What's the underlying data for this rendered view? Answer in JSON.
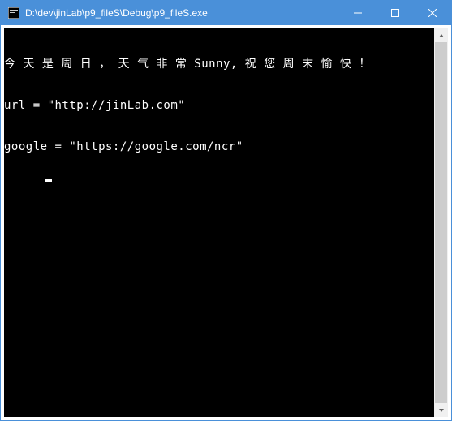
{
  "titlebar": {
    "title": "D:\\dev\\jinLab\\p9_fileS\\Debug\\p9_fileS.exe"
  },
  "console": {
    "line1": "今 天 是 周 日 ， 天 气 非 常 Sunny, 祝 您 周 末 愉 快 ！",
    "line2": "url = \"http://jinLab.com\"",
    "line3": "google = \"https://google.com/ncr\""
  }
}
